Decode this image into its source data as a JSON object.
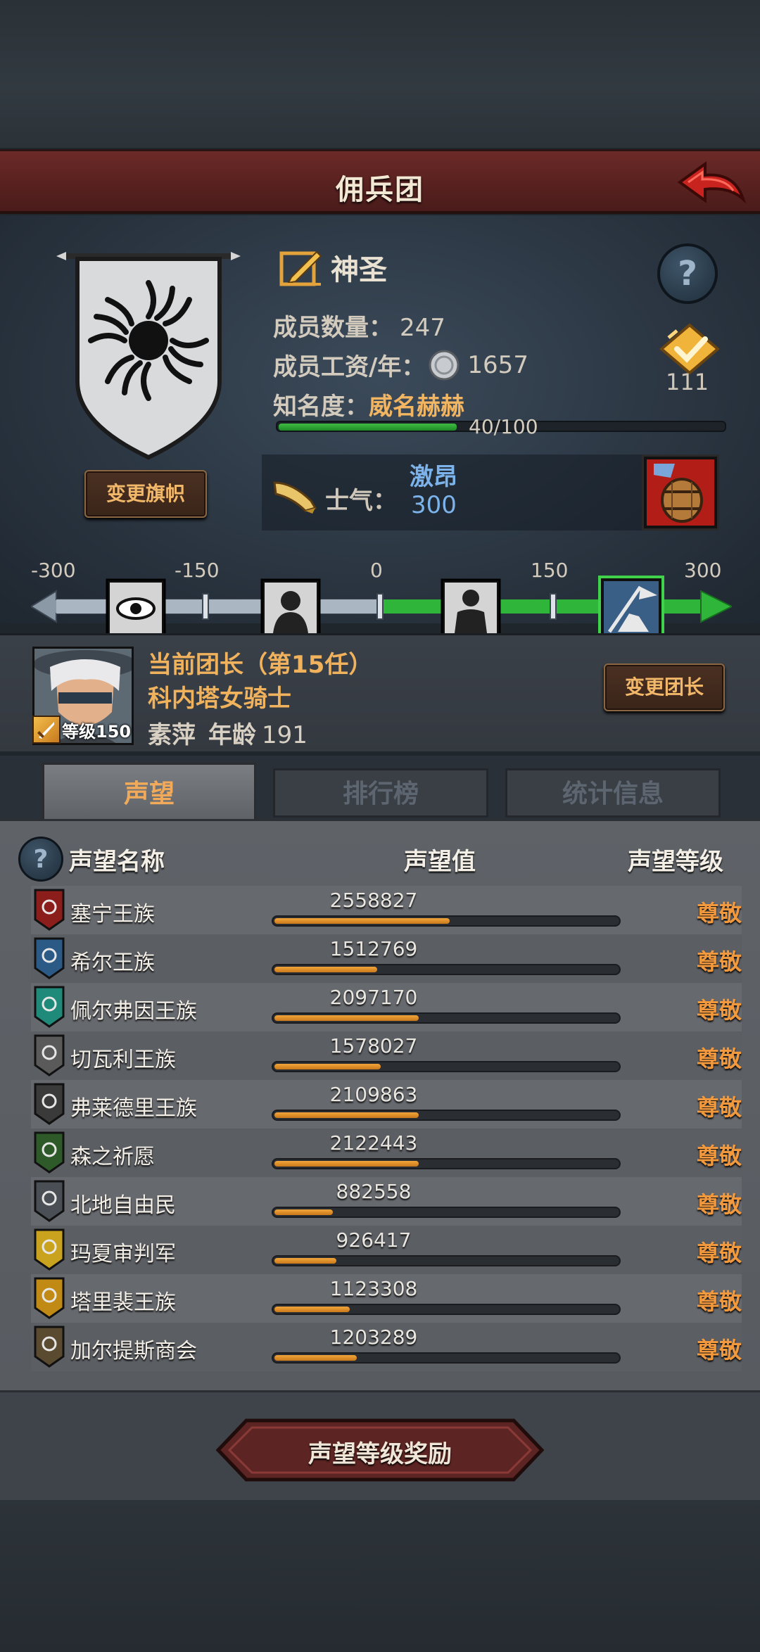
{
  "header": {
    "title": "佣兵团"
  },
  "guild": {
    "name": "神圣",
    "member_count_label": "成员数量：",
    "member_count": "247",
    "wage_label": "成员工资/年：",
    "wage": "1657",
    "fame_label": "知名度：",
    "fame_value": "威名赫赫",
    "fame_progress_text": "40/100",
    "fame_progress": 0.4,
    "change_banner_label": "变更旗帜",
    "medal_count": "111",
    "help_glyph": "?"
  },
  "morale": {
    "label": "士气：",
    "state": "激昂",
    "value": "300",
    "scale_ticks": [
      "-300",
      "-150",
      "0",
      "150",
      "300"
    ]
  },
  "leader": {
    "title": "当前团长（第15任）",
    "class_name": "科内塔女骑士",
    "name": "素萍",
    "age_label": "年龄",
    "age": "191",
    "level_text": "等级150",
    "change_leader_label": "变更团长"
  },
  "tabs": [
    {
      "label": "声望",
      "active": true
    },
    {
      "label": "排行榜",
      "active": false
    },
    {
      "label": "统计信息",
      "active": false
    }
  ],
  "reputation": {
    "help_glyph": "?",
    "col_name": "声望名称",
    "col_value": "声望值",
    "col_level": "声望等级",
    "rows": [
      {
        "name": "塞宁王族",
        "value": "2558827",
        "level": "尊敬",
        "fill": 0.51,
        "color": "#8b1d1a",
        "icon": "crimson-banner-icon"
      },
      {
        "name": "希尔王族",
        "value": "1512769",
        "level": "尊敬",
        "fill": 0.3,
        "color": "#2c5a86",
        "icon": "blue-banner-icon"
      },
      {
        "name": "佩尔弗因王族",
        "value": "2097170",
        "level": "尊敬",
        "fill": 0.42,
        "color": "#1f8a7a",
        "icon": "teal-banner-icon"
      },
      {
        "name": "切瓦利王族",
        "value": "1578027",
        "level": "尊敬",
        "fill": 0.31,
        "color": "#5a5a5a",
        "icon": "scales-banner-icon"
      },
      {
        "name": "弗莱德里王族",
        "value": "2109863",
        "level": "尊敬",
        "fill": 0.42,
        "color": "#3a3a3a",
        "icon": "wolf-banner-icon"
      },
      {
        "name": "森之祈愿",
        "value": "2122443",
        "level": "尊敬",
        "fill": 0.42,
        "color": "#2e5a2a",
        "icon": "tree-banner-icon"
      },
      {
        "name": "北地自由民",
        "value": "882558",
        "level": "尊敬",
        "fill": 0.17,
        "color": "#4a4f55",
        "icon": "axe-banner-icon"
      },
      {
        "name": "玛夏审判军",
        "value": "926417",
        "level": "尊敬",
        "fill": 0.18,
        "color": "#c9a21e",
        "icon": "yellow-cross-banner-icon"
      },
      {
        "name": "塔里裴王族",
        "value": "1123308",
        "level": "尊敬",
        "fill": 0.22,
        "color": "#c08a14",
        "icon": "flame-banner-icon"
      },
      {
        "name": "加尔提斯商会",
        "value": "1203289",
        "level": "尊敬",
        "fill": 0.24,
        "color": "#5a4a30",
        "icon": "chest-banner-icon"
      }
    ]
  },
  "reward_button": {
    "label": "声望等级奖励"
  },
  "colors": {
    "accent_orange": "#f2993e",
    "morale_blue": "#7cb3ea",
    "header_red": "#6c2a28"
  }
}
